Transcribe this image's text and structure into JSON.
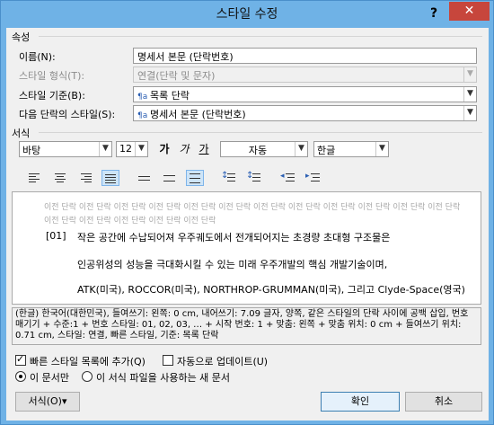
{
  "window": {
    "title": "스타일 수정",
    "help": "?",
    "close": "✕"
  },
  "properties": {
    "section_label": "속성",
    "name_label": "이름(N):",
    "name_value": "명세서 본문 (단락번호)",
    "type_label": "스타일 형식(T):",
    "type_value": "연결(단락 및 문자)",
    "based_label": "스타일 기준(B):",
    "based_value": "목록 단락",
    "next_label": "다음 단락의 스타일(S):",
    "next_value": "명세서 본문 (단락번호)"
  },
  "format": {
    "section_label": "서식",
    "font": "바탕",
    "size": "12",
    "bold": "가",
    "italic": "가",
    "underline": "가",
    "color": "자동",
    "language": "한글"
  },
  "preview": {
    "previous_text": "이전 단락 이전 단락 이전 단락 이전 단락 이전 단락 이전 단락 이전 단락 이전 단락 이전 단락 이전 단락 이전 단락 이전 단락 이전 단락 이전 단락 이전 단락 이전 단락 이전 단락",
    "number": "[01]",
    "line1": "작은 공간에 수납되어져 우주궤도에서 전개되어지는 초경량 초대형 구조물은",
    "line2": "인공위성의 성능을 극대화시킬 수 있는 미래 우주개발의 핵심 개발기술이며,",
    "line3": "ATK(미국), ROCCOR(미국), NORTHROP-GRUMMAN(미국), 그리고 Clyde-Space(영국)"
  },
  "description": "(한글) 한국어(대한민국), 들여쓰기: 왼쪽: 0 cm, 내어쓰기: 7.09 글자, 양쪽, 같은 스타일의 단락 사이에 공백 삽입, 번호 매기기 + 수준:1 + 번호 스타일: 01, 02, 03, … + 시작 번호: 1 + 맞춤: 왼쪽 + 맞춤 위치: 0 cm + 들여쓰기 위치: 0.71 cm, 스타일: 연결, 빠른 스타일, 기준: 목록 단락",
  "options": {
    "add_quick": "빠른 스타일 목록에 추가(Q)",
    "auto_update": "자동으로 업데이트(U)",
    "this_doc": "이 문서만",
    "new_docs": "이 서식 파일을 사용하는 새 문서"
  },
  "buttons": {
    "format": "서식(O)▾",
    "ok": "확인",
    "cancel": "취소"
  }
}
